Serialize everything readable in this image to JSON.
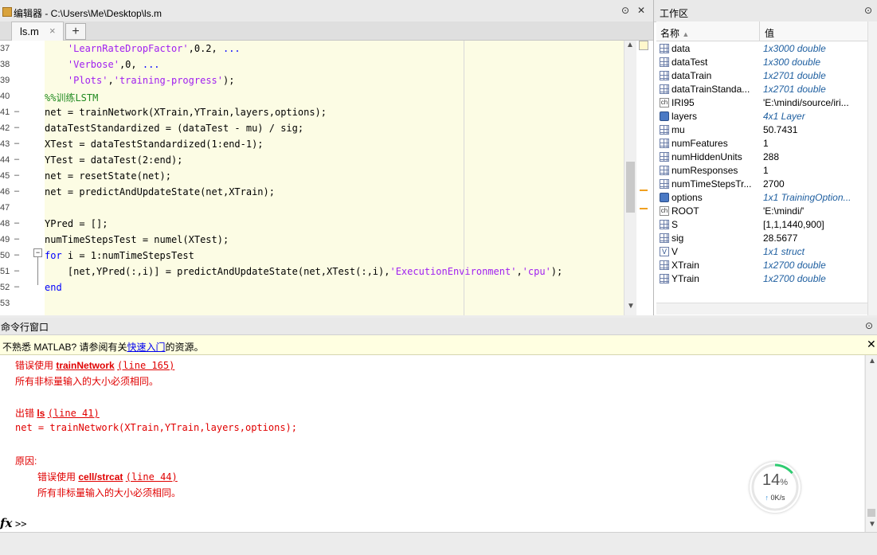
{
  "editor": {
    "title": "编辑器 - C:\\Users\\Me\\Desktop\\ls.m",
    "tab_label": "ls.m",
    "tab_close": "×",
    "add_tab": "+",
    "lines": [
      {
        "num": "37",
        "dash": "",
        "parts": [
          {
            "t": "    ",
            "c": ""
          },
          {
            "t": "'LearnRateDropFactor'",
            "c": "str"
          },
          {
            "t": ",0.2, ",
            "c": ""
          },
          {
            "t": "...",
            "c": "kw"
          }
        ]
      },
      {
        "num": "38",
        "dash": "",
        "parts": [
          {
            "t": "    ",
            "c": ""
          },
          {
            "t": "'Verbose'",
            "c": "str"
          },
          {
            "t": ",0, ",
            "c": ""
          },
          {
            "t": "...",
            "c": "kw"
          }
        ]
      },
      {
        "num": "39",
        "dash": "",
        "parts": [
          {
            "t": "    ",
            "c": ""
          },
          {
            "t": "'Plots'",
            "c": "str"
          },
          {
            "t": ",",
            "c": ""
          },
          {
            "t": "'training-progress'",
            "c": "str"
          },
          {
            "t": ");",
            "c": ""
          }
        ]
      },
      {
        "num": "40",
        "dash": "",
        "parts": [
          {
            "t": "%%训练LSTM",
            "c": "cm"
          }
        ]
      },
      {
        "num": "41",
        "dash": "–",
        "parts": [
          {
            "t": "net = trainNetwork(XTrain,YTrain,layers,options);",
            "c": ""
          }
        ]
      },
      {
        "num": "42",
        "dash": "–",
        "parts": [
          {
            "t": "dataTestStandardized = (dataTest - mu) / sig;",
            "c": ""
          }
        ]
      },
      {
        "num": "43",
        "dash": "–",
        "parts": [
          {
            "t": "XTest = dataTestStandardized(1:end-1);",
            "c": ""
          }
        ]
      },
      {
        "num": "44",
        "dash": "–",
        "parts": [
          {
            "t": "YTest = dataTest(2:end);",
            "c": ""
          }
        ]
      },
      {
        "num": "45",
        "dash": "–",
        "parts": [
          {
            "t": "net = resetState(net);",
            "c": ""
          }
        ]
      },
      {
        "num": "46",
        "dash": "–",
        "parts": [
          {
            "t": "net = predictAndUpdateState(net,XTrain);",
            "c": ""
          }
        ]
      },
      {
        "num": "47",
        "dash": "",
        "parts": [
          {
            "t": "",
            "c": ""
          }
        ]
      },
      {
        "num": "48",
        "dash": "–",
        "parts": [
          {
            "t": "YPred = [];",
            "c": ""
          }
        ]
      },
      {
        "num": "49",
        "dash": "–",
        "parts": [
          {
            "t": "numTimeStepsTest = numel(XTest);",
            "c": ""
          }
        ]
      },
      {
        "num": "50",
        "dash": "–",
        "parts": [
          {
            "t": "for",
            "c": "kw"
          },
          {
            "t": " i = 1:numTimeStepsTest",
            "c": ""
          }
        ]
      },
      {
        "num": "51",
        "dash": "–",
        "parts": [
          {
            "t": "    [net,YPred(:,i)] = predictAndUpdateState(net,XTest(:,i),",
            "c": ""
          },
          {
            "t": "'ExecutionEnvironment'",
            "c": "str"
          },
          {
            "t": ",",
            "c": ""
          },
          {
            "t": "'cpu'",
            "c": "str"
          },
          {
            "t": ");",
            "c": ""
          }
        ]
      },
      {
        "num": "52",
        "dash": "–",
        "parts": [
          {
            "t": "end",
            "c": "kw"
          }
        ]
      },
      {
        "num": "53",
        "dash": "",
        "parts": [
          {
            "t": "",
            "c": ""
          }
        ]
      }
    ]
  },
  "workspace": {
    "title": "工作区",
    "col_name": "名称",
    "col_value": "值",
    "rows": [
      {
        "icon": "grid",
        "name": "data",
        "value": "1x3000 double",
        "italic": true
      },
      {
        "icon": "grid",
        "name": "dataTest",
        "value": "1x300 double",
        "italic": true
      },
      {
        "icon": "grid",
        "name": "dataTrain",
        "value": "1x2701 double",
        "italic": true
      },
      {
        "icon": "grid",
        "name": "dataTrainStanda...",
        "value": "1x2701 double",
        "italic": true
      },
      {
        "icon": "ch",
        "name": "IRI95",
        "value": "'E:\\mindi/source/iri...",
        "italic": false
      },
      {
        "icon": "obj",
        "name": "layers",
        "value": "4x1 Layer",
        "italic": true
      },
      {
        "icon": "grid",
        "name": "mu",
        "value": "50.7431",
        "italic": false
      },
      {
        "icon": "grid",
        "name": "numFeatures",
        "value": "1",
        "italic": false
      },
      {
        "icon": "grid",
        "name": "numHiddenUnits",
        "value": "288",
        "italic": false
      },
      {
        "icon": "grid",
        "name": "numResponses",
        "value": "1",
        "italic": false
      },
      {
        "icon": "grid",
        "name": "numTimeStepsTr...",
        "value": "2700",
        "italic": false
      },
      {
        "icon": "obj",
        "name": "options",
        "value": "1x1 TrainingOption...",
        "italic": true
      },
      {
        "icon": "ch",
        "name": "ROOT",
        "value": "'E:\\mindi/'",
        "italic": false
      },
      {
        "icon": "grid",
        "name": "S",
        "value": "[1,1,1440,900]",
        "italic": false
      },
      {
        "icon": "grid",
        "name": "sig",
        "value": "28.5677",
        "italic": false
      },
      {
        "icon": "st",
        "name": "V",
        "value": "1x1 struct",
        "italic": true
      },
      {
        "icon": "grid",
        "name": "XTrain",
        "value": "1x2700 double",
        "italic": true
      },
      {
        "icon": "grid",
        "name": "YTrain",
        "value": "1x2700 double",
        "italic": true
      }
    ]
  },
  "command": {
    "title": "命令行窗口",
    "notice_prefix": "不熟悉 MATLAB? 请参阅有关",
    "notice_link": "快速入门",
    "notice_suffix": "的资源。",
    "err1_prefix": "错误使用 ",
    "err1_func": "trainNetwork",
    "err1_line": "(line 165)",
    "err1_msg": "所有非标量输入的大小必须相同。",
    "err2_prefix": "出错 ",
    "err2_func": "ls",
    "err2_line": "(line 41)",
    "err2_code": "net = trainNetwork(XTrain,YTrain,layers,options);",
    "cause_label": "原因:",
    "err3_prefix": "错误使用 ",
    "err3_func": "cell/strcat",
    "err3_line": "(line 44)",
    "err3_msg": "所有非标量输入的大小必须相同。",
    "fx": "fx",
    "prompt": ">>"
  },
  "speed_widget": {
    "percent_value": "14",
    "percent_sign": "%",
    "rate": "0K/s",
    "progress": 0.14,
    "accent": "#2ecc71"
  },
  "colors": {
    "error": "#e00000",
    "string": "#a020f0",
    "keyword": "#0000ff",
    "comment": "#228b22",
    "code_bg": "#fcfce4"
  }
}
